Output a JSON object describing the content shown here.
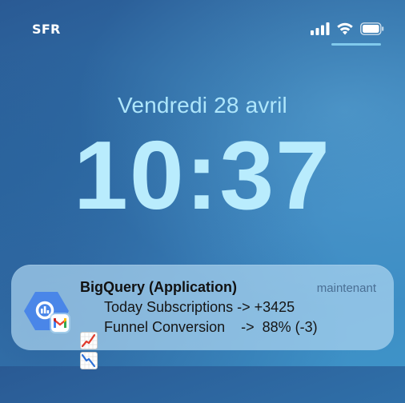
{
  "status_bar": {
    "carrier": "SFR",
    "icons": [
      "cellular-signal-icon",
      "wifi-icon",
      "battery-icon"
    ]
  },
  "lock_screen": {
    "date": "Vendredi 28 avril",
    "time": "10:37"
  },
  "notification": {
    "app_name": "BigQuery (Application)",
    "timestamp": "maintenant",
    "app_icon": "bigquery-icon",
    "badge_icon": "gmail-icon",
    "lines": [
      {
        "icon": "chart-increasing-icon",
        "text": "Today Subscriptions -> +3425"
      },
      {
        "icon": "chart-decreasing-icon",
        "text": "Funnel Conversion    ->  88% (-3)"
      }
    ]
  },
  "colors": {
    "clock": "#b9ecfd",
    "notification_bg": "#aad4f0",
    "bigquery_blue": "#4a86e8"
  }
}
